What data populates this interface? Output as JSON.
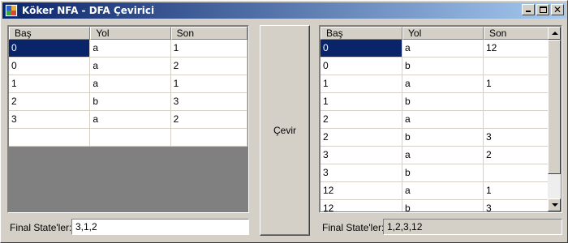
{
  "window": {
    "title": "Köker NFA - DFA Çevirici"
  },
  "titlebar_buttons": {
    "minimize": "minimize-icon",
    "maximize": "maximize-icon",
    "close": "close-icon",
    "close_glyph": "✕"
  },
  "left_table": {
    "columns": [
      "Baş",
      "Yol",
      "Son"
    ],
    "rows": [
      [
        "0",
        "a",
        "1"
      ],
      [
        "0",
        "a",
        "2"
      ],
      [
        "1",
        "a",
        "1"
      ],
      [
        "2",
        "b",
        "3"
      ],
      [
        "3",
        "a",
        "2"
      ],
      [
        "",
        "",
        ""
      ]
    ],
    "selected_row": 0
  },
  "convert_button": {
    "label": "Çevir"
  },
  "right_table": {
    "columns": [
      "Baş",
      "Yol",
      "Son"
    ],
    "rows": [
      [
        "0",
        "a",
        "12"
      ],
      [
        "0",
        "b",
        ""
      ],
      [
        "1",
        "a",
        "1"
      ],
      [
        "1",
        "b",
        ""
      ],
      [
        "2",
        "a",
        ""
      ],
      [
        "2",
        "b",
        "3"
      ],
      [
        "3",
        "a",
        "2"
      ],
      [
        "3",
        "b",
        ""
      ],
      [
        "12",
        "a",
        "1"
      ],
      [
        "12",
        "b",
        "3"
      ]
    ],
    "selected_row": 0
  },
  "left_final": {
    "label": "Final State'ler:",
    "value": "3,1,2"
  },
  "right_final": {
    "label": "Final State'ler:",
    "value": "1,2,3,12"
  },
  "colors": {
    "title_start": "#0a246a",
    "title_end": "#a6caf0",
    "selection": "#0a246a",
    "face": "#d4d0c8"
  }
}
